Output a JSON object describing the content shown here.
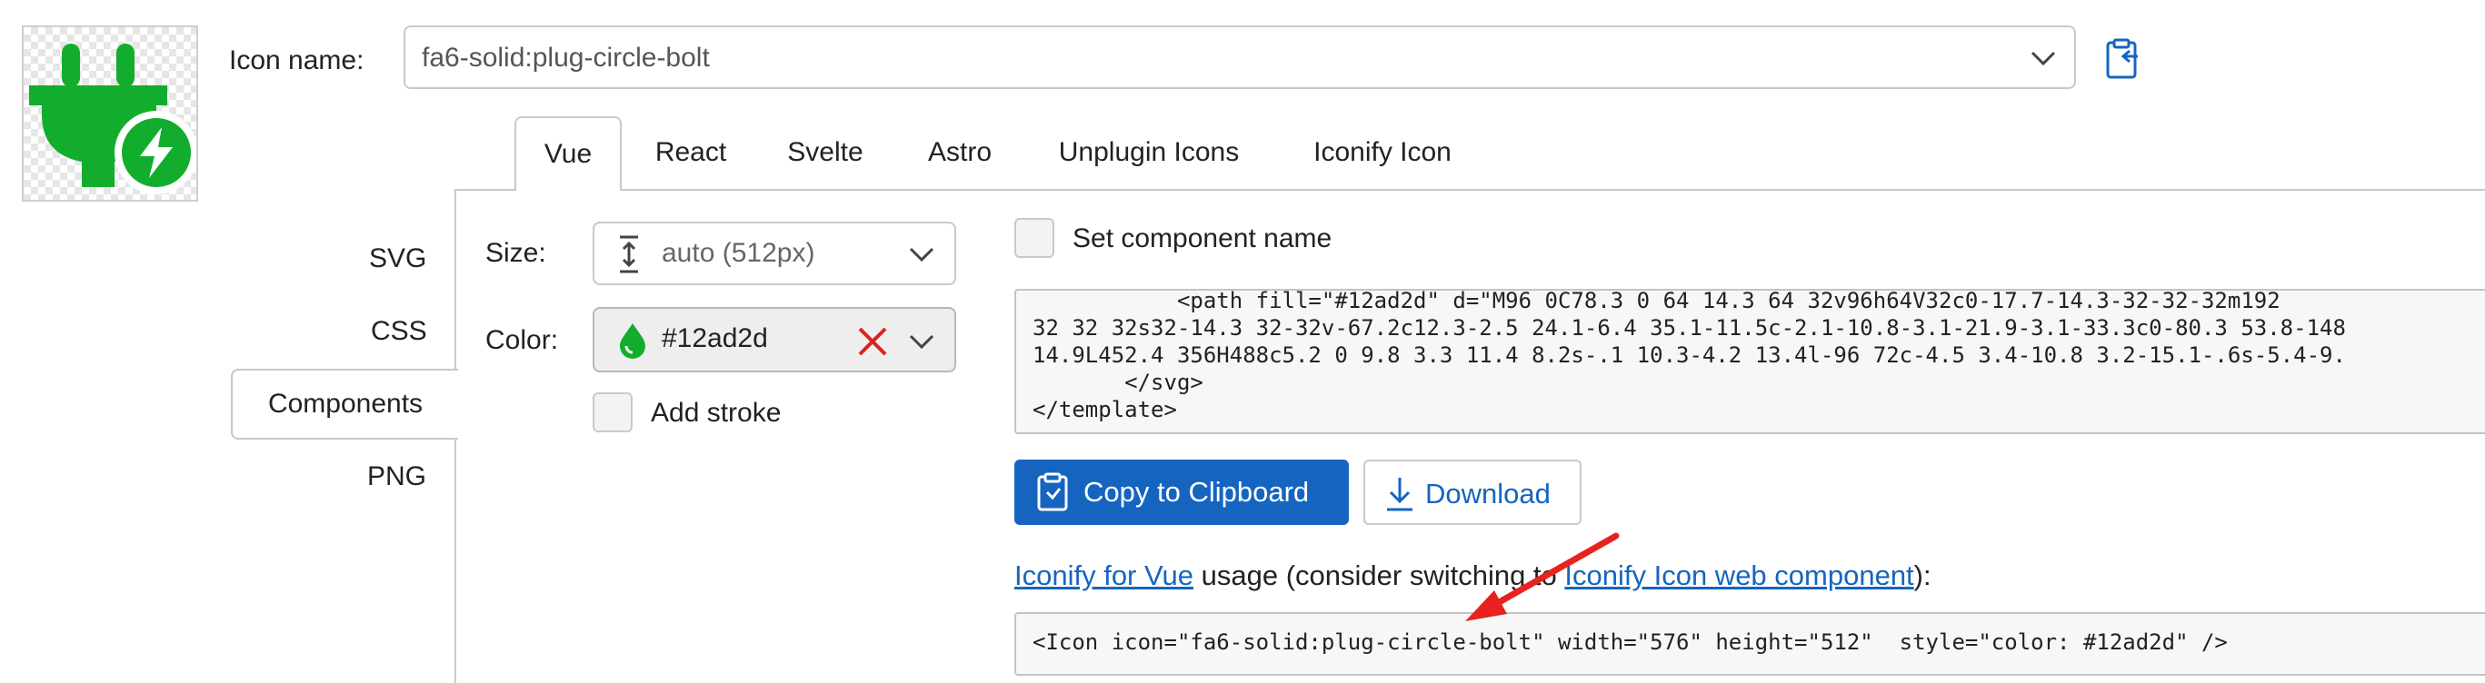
{
  "app": {
    "accent_color": "#1565c0",
    "icon_color": "#12ad2d"
  },
  "preview": {
    "icon": "plug-circle-bolt-icon"
  },
  "icon_name": {
    "label": "Icon name:",
    "value": "fa6-solid:plug-circle-bolt",
    "paste_icon": "clipboard-paste-icon"
  },
  "tabs": [
    {
      "label": "Vue",
      "active": true
    },
    {
      "label": "React"
    },
    {
      "label": "Svelte"
    },
    {
      "label": "Astro"
    },
    {
      "label": "Unplugin Icons"
    },
    {
      "label": "Iconify Icon"
    }
  ],
  "nav": [
    {
      "label": "SVG"
    },
    {
      "label": "CSS"
    },
    {
      "label": "Components",
      "active": true
    },
    {
      "label": "PNG"
    }
  ],
  "options": {
    "size_label": "Size:",
    "size_value": "auto (512px)",
    "color_label": "Color:",
    "color_value": "#12ad2d",
    "add_stroke_label": "Add stroke",
    "set_component_name_label": "Set component name"
  },
  "code": {
    "lines": [
      "           <path fill=\"#12ad2d\" d=\"M96 0C78.3 0 64 14.3 64 32v96h64V32c0-17.7-14.3-32-32-32m192",
      "32 32 32s32-14.3 32-32v-67.2c12.3-2.5 24.1-6.4 35.1-11.5c-2.1-10.8-3.1-21.9-3.1-33.3c0-80.3 53.8-148",
      "14.9L452.4 356H488c5.2 0 9.8 3.3 11.4 8.2s-.1 10.3-4.2 13.4l-96 72c-4.5 3.4-10.8 3.2-15.1-.6s-5.4-9.",
      "       </svg>",
      "</template>"
    ]
  },
  "buttons": {
    "copy": "Copy to Clipboard",
    "download": "Download"
  },
  "usage": {
    "link1": "Iconify for Vue",
    "text1": " usage (consider switching to ",
    "link2": "Iconify Icon web component",
    "text2": "):",
    "code": "<Icon icon=\"fa6-solid:plug-circle-bolt\" width=\"576\" height=\"512\"  style=\"color: #12ad2d\" />"
  }
}
